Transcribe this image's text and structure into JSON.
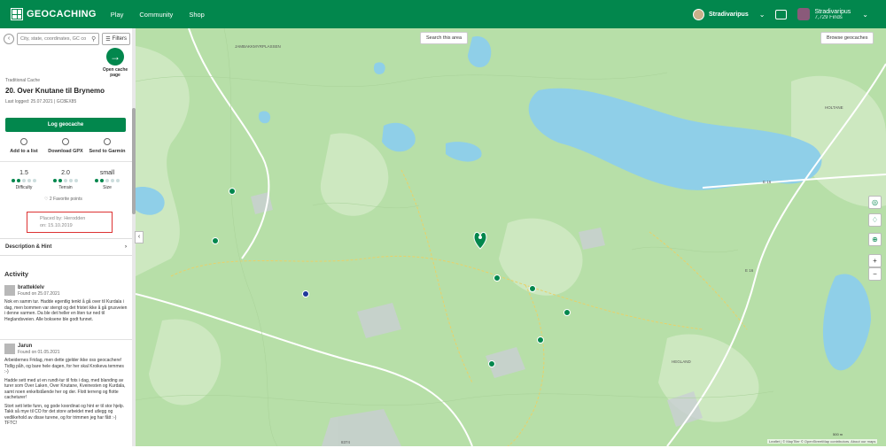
{
  "header": {
    "logo_text": "GEOCACHING",
    "nav": [
      "Play",
      "Community",
      "Shop"
    ],
    "user1": "Stradivaripus",
    "user2": "Stradivaripus",
    "user2_finds": "7,729 Finds",
    "brand_color": "#02874d"
  },
  "sidebar": {
    "search_placeholder": "City, state, coordinates, GC co",
    "filters_label": "Filters",
    "open_cache_label": "Open cache page",
    "cache_type": "Traditional Cache",
    "cache_title": "20. Over Knutane til Brynemo",
    "last_logged": "Last logged: 25.07.2021  |  GC8EX85",
    "log_button": "Log geocache",
    "actions": [
      "Add to a list",
      "Download GPX",
      "Send to Garmin"
    ],
    "ratings": [
      {
        "value": "1.5",
        "label": "Difficulty",
        "level": 0.3
      },
      {
        "value": "2.0",
        "label": "Terrain",
        "level": 0.4
      },
      {
        "value": "small",
        "label": "Size",
        "level": 0.4
      }
    ],
    "favorites": "2 Favorite points",
    "placed_by": "Placed by: Herodden",
    "placed_on": "on: 15.10.2019",
    "description_hint": "Description & Hint",
    "activity_heading": "Activity",
    "logs": [
      {
        "user": "bratteklelv",
        "found": "Found on 25.07.2021",
        "text": "Nok en samm tur. Hadde egentlig tenkt å gå over til Kurdala i dag, men bommen var stengt og det fristet ikke å gå grusveien i denne varmen. Da ble det heller en liten tur ned til Heglandsveien. Alle boksene ble godt funnet."
      },
      {
        "user": "Jarun",
        "found": "Found on 01.05.2021",
        "text": "Arbeidernes Fridag, men dette gjelder ikke oss geocachere! Tidlig påh, og bare hele dagen, for her skal Kroikeva temmes :-)",
        "text2": "Hadde sett med ut en rundt-tur til fots i dag, med blanding av turer som Over Laken, Over Knutane, Kveinesten og Kurdala, samt noen enkeltstående her og der. Flott terreng og flotte cacheturer!",
        "text3": "Stort sett lette funn, og gode koordinat og hint er til stor hjelp. Takk så mye til CO for det store arbeidet med utlegg og vedlikehold av disse turene, og for trimmen jeg har fått :-) TFTC!"
      }
    ]
  },
  "map": {
    "search_area": "Search this area",
    "browse": "Browse geocaches",
    "labels": [
      "JAMBAKKMYRPLASSEN",
      "HOLTANE",
      "HEGLAND",
      "E 16",
      "E 16",
      "8374"
    ],
    "attribution": "Leaflet | © MapTiler © OpenStreetMap contributors. About our maps",
    "scale": "500 m"
  }
}
